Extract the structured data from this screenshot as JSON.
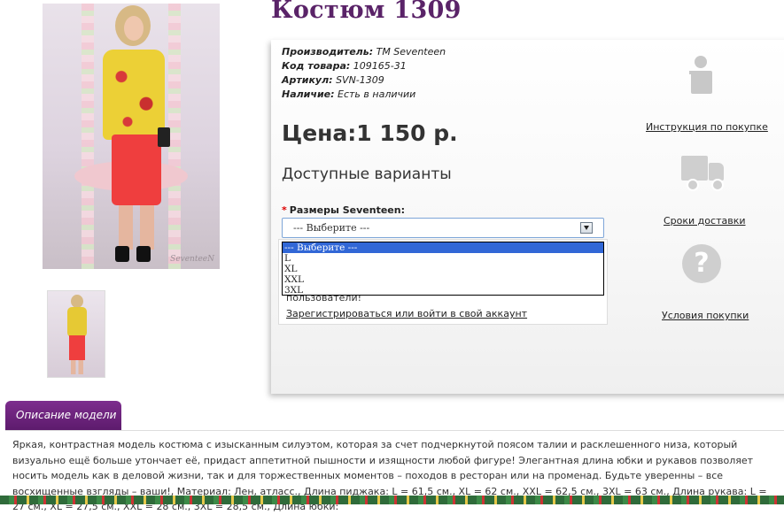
{
  "product": {
    "title": "Костюм 1309",
    "photo_watermark": "SeventeeN",
    "meta": {
      "manufacturer_label": "Производитель:",
      "manufacturer_value": "TM Seventeen",
      "code_label": "Код товара:",
      "code_value": "109165-31",
      "sku_label": "Артикул:",
      "sku_value": "SVN-1309",
      "availability_label": "Наличие:",
      "availability_value": "Есть в наличии"
    },
    "price": "Цена:1 150 р.",
    "variants_heading": "Доступные варианты",
    "sizes": {
      "required_mark": "*",
      "label": "Размеры Seventeen:",
      "selected": "--- Выберите ---",
      "options": [
        "--- Выберите ---",
        "L",
        "XL",
        "XXL",
        "3XL"
      ]
    },
    "login_notice": "пользователи!",
    "login_link": "Зарегистрироваться или войти в свой аккаунт"
  },
  "sidebar": {
    "instruction_link": "Инструкция по покупке",
    "delivery_link": "Сроки доставки",
    "terms_link": "Условия покупки",
    "qmark": "?"
  },
  "description": {
    "tab_label": "Описание модели",
    "text": "Яркая, контрастная модель костюма с изысканным силуэтом, которая за счет подчеркнутой поясом талии и расклешенного низа, который визуально ещё больше утончает её, придаст аппетитной пышности и изящности любой фигуре! Элегантная длина юбки и рукавов позволяет носить модель как в деловой жизни, так и для торжественных моментов – походов в ресторан или на променад. Будьте уверенны – все восхищенные взгляды – ваши!, Материал: Лен, атласс., Длина пиджака: L = 61,5 см., XL = 62 см., XXL = 62,5 см., 3XL = 63 см., Длина рукава: L = 27 см., XL = 27,5 см., XXL = 28 см., 3XL = 28,5 см., Длина юбки:"
  },
  "colors": {
    "title": "#5a2368",
    "tab": "#6b2380",
    "dropdown_highlight": "#3167d6",
    "icon_gray": "#c8c8c8"
  }
}
